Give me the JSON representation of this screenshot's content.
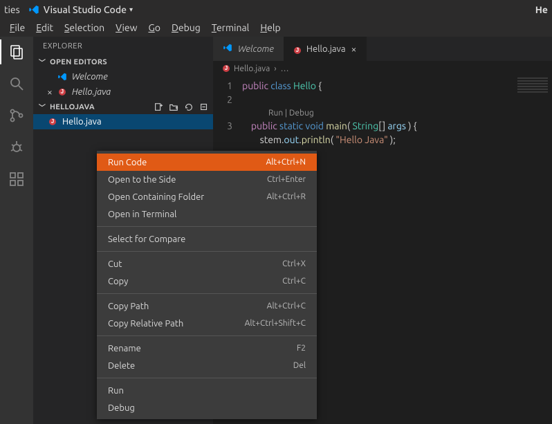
{
  "os_bar": {
    "activities_label": "ties",
    "app_name": "Visual Studio Code",
    "dropdown_arrow": "▾",
    "right_text": "He"
  },
  "menubar": [
    {
      "accel": "F",
      "rest": "ile"
    },
    {
      "accel": "E",
      "rest": "dit"
    },
    {
      "accel": "S",
      "rest": "election"
    },
    {
      "accel": "V",
      "rest": "iew"
    },
    {
      "accel": "G",
      "rest": "o"
    },
    {
      "accel": "D",
      "rest": "ebug"
    },
    {
      "accel": "T",
      "rest": "erminal"
    },
    {
      "accel": "H",
      "rest": "elp"
    }
  ],
  "sidebar": {
    "title": "EXPLORER",
    "open_editors_label": "OPEN EDITORS",
    "open_editors": [
      {
        "icon": "vscode",
        "label": "Welcome",
        "modified": false
      },
      {
        "icon": "java",
        "label": "Hello.java",
        "modified": true
      }
    ],
    "project_label": "HELLOJAVA",
    "project_files": [
      {
        "icon": "java",
        "label": "Hello.java"
      }
    ]
  },
  "editor": {
    "tabs": [
      {
        "icon": "vscode",
        "label": "Welcome",
        "active": false
      },
      {
        "icon": "java",
        "label": "Hello.java",
        "active": true,
        "closable": true
      }
    ],
    "breadcrumb": {
      "icon": "java",
      "file": "Hello.java",
      "sep": "›",
      "more": "…"
    },
    "code": {
      "codelens": "Run | Debug",
      "lines": [
        {
          "n": "1",
          "html": "<span class='k-purple'>public</span> <span class='k-blue'>class</span> <span class='tk-type'>Hello</span> {"
        },
        {
          "n": "2",
          "html": ""
        },
        {
          "n": "3",
          "html": "    <span class='k-purple'>public</span> <span class='k-blue'>static</span> <span class='k-blue'>void</span> <span class='tk-fn'>main</span>( <span class='tk-type'>String</span>[] <span class='tk-var'>args</span> ) {"
        },
        {
          "n": " ",
          "html": "        stem.<span class='tk-var'>out</span>.<span class='tk-fn'>println</span>( <span class='tk-str'>\"Hello Java\"</span> );"
        }
      ]
    }
  },
  "context_menu": [
    {
      "type": "item",
      "label": "Run Code",
      "shortcut": "Alt+Ctrl+N",
      "highlight": true
    },
    {
      "type": "item",
      "label": "Open to the Side",
      "shortcut": "Ctrl+Enter"
    },
    {
      "type": "item",
      "label": "Open Containing Folder",
      "shortcut": "Alt+Ctrl+R"
    },
    {
      "type": "item",
      "label": "Open in Terminal",
      "shortcut": ""
    },
    {
      "type": "sep"
    },
    {
      "type": "item",
      "label": "Select for Compare",
      "shortcut": ""
    },
    {
      "type": "sep"
    },
    {
      "type": "item",
      "label": "Cut",
      "shortcut": "Ctrl+X"
    },
    {
      "type": "item",
      "label": "Copy",
      "shortcut": "Ctrl+C"
    },
    {
      "type": "sep"
    },
    {
      "type": "item",
      "label": "Copy Path",
      "shortcut": "Alt+Ctrl+C"
    },
    {
      "type": "item",
      "label": "Copy Relative Path",
      "shortcut": "Alt+Ctrl+Shift+C"
    },
    {
      "type": "sep"
    },
    {
      "type": "item",
      "label": "Rename",
      "shortcut": "F2"
    },
    {
      "type": "item",
      "label": "Delete",
      "shortcut": "Del"
    },
    {
      "type": "sep"
    },
    {
      "type": "item",
      "label": "Run",
      "shortcut": ""
    },
    {
      "type": "item",
      "label": "Debug",
      "shortcut": ""
    }
  ]
}
